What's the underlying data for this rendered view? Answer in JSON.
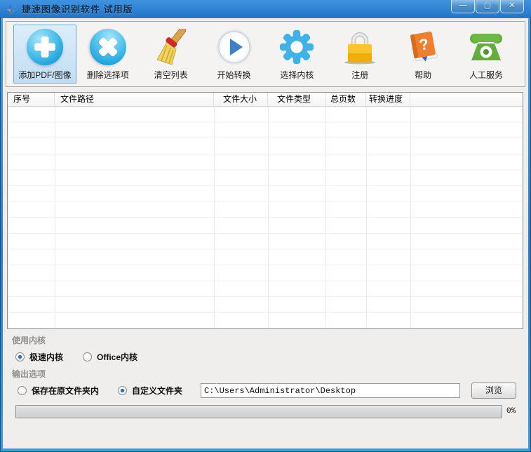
{
  "window": {
    "title": "捷速图像识别软件 试用版",
    "controls": {
      "minimize": "—",
      "maximize": "▢",
      "close": "✕"
    }
  },
  "toolbar": {
    "buttons": [
      {
        "label": "添加PDF/图像",
        "icon": "add-plus-icon",
        "selected": true
      },
      {
        "label": "删除选择项",
        "icon": "delete-x-icon",
        "selected": false
      },
      {
        "label": "清空列表",
        "icon": "broom-icon",
        "selected": false
      },
      {
        "label": "开始转换",
        "icon": "play-icon",
        "selected": false
      },
      {
        "label": "选择内核",
        "icon": "gear-icon",
        "selected": false
      },
      {
        "label": "注册",
        "icon": "lock-icon",
        "selected": false
      },
      {
        "label": "帮助",
        "icon": "help-book-icon",
        "selected": false
      },
      {
        "label": "人工服务",
        "icon": "phone-icon",
        "selected": false
      }
    ]
  },
  "table": {
    "columns": [
      {
        "label": "序号"
      },
      {
        "label": "文件路径"
      },
      {
        "label": "文件大小"
      },
      {
        "label": "文件类型"
      },
      {
        "label": "总页数"
      },
      {
        "label": "转换进度"
      }
    ],
    "rows": []
  },
  "kernel_section": {
    "title": "使用内核",
    "options": [
      {
        "label": "极速内核",
        "selected": true
      },
      {
        "label": "Office内核",
        "selected": false
      }
    ]
  },
  "output_section": {
    "title": "输出选项",
    "options": [
      {
        "label": "保存在原文件夹内",
        "selected": false
      },
      {
        "label": "自定义文件夹",
        "selected": true
      }
    ],
    "path_value": "C:\\Users\\Administrator\\Desktop",
    "browse_label": "浏览"
  },
  "progress": {
    "value": 0,
    "percent_label": "0%"
  },
  "colors": {
    "titlebar_blue": "#2e82d4",
    "accent_blue": "#2aa4dc",
    "lock_gold": "#efae0c",
    "phone_green": "#64ad3d",
    "book_orange": "#ee7f30"
  }
}
